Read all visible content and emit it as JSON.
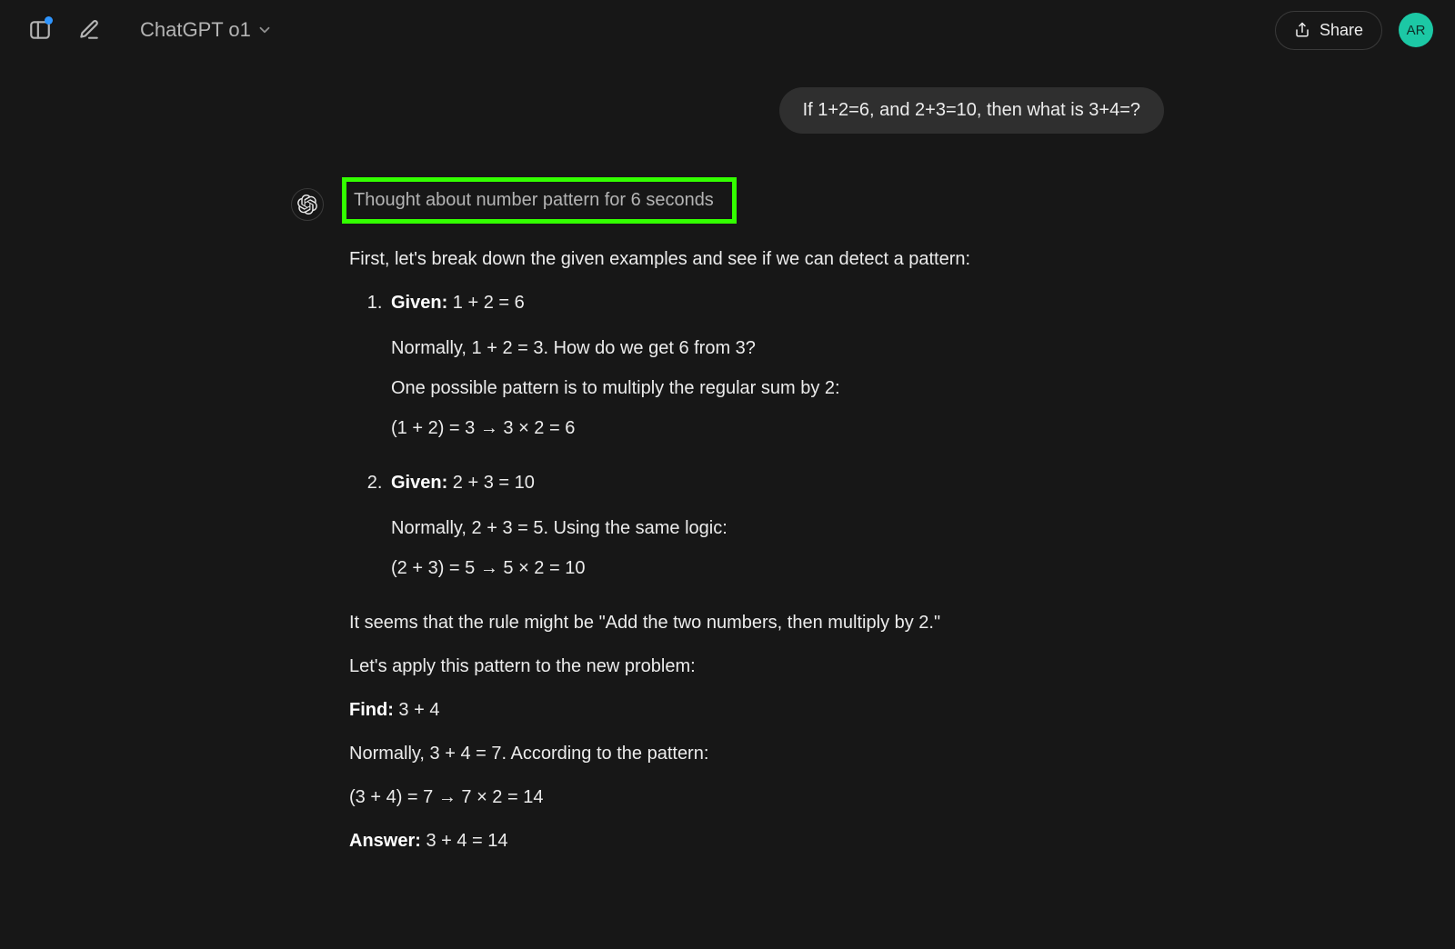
{
  "header": {
    "model_label": "ChatGPT o1",
    "share_label": "Share",
    "avatar_initials": "AR"
  },
  "conversation": {
    "user_message": "If 1+2=6, and 2+3=10, then what is 3+4=?",
    "thought_text": "Thought about number pattern for 6 seconds",
    "response": {
      "intro": "First, let's break down the given examples and see if we can detect a pattern:",
      "item1": {
        "label": "Given:",
        "eq": " 1 + 2 = 6",
        "line_a": "Normally, 1 + 2 = 3. How do we get 6 from 3?",
        "line_b": "One possible pattern is to multiply the regular sum by 2:",
        "line_c": "(1 + 2) = 3 → 3 × 2 = 6"
      },
      "item2": {
        "label": "Given:",
        "eq": " 2 + 3 = 10",
        "line_a": "Normally, 2 + 3 = 5. Using the same logic:",
        "line_b": "(2 + 3) = 5 → 5 × 2 = 10"
      },
      "rule": "It seems that the rule might be \"Add the two numbers, then multiply by 2.\"",
      "apply": "Let's apply this pattern to the new problem:",
      "find_label": "Find:",
      "find_eq": " 3 + 4",
      "normally": "Normally, 3 + 4 = 7. According to the pattern:",
      "calc": "(3 + 4) = 7 → 7 × 2 = 14",
      "answer_label": "Answer:",
      "answer_eq": " 3 + 4 = 14"
    }
  },
  "highlight_color": "#33ff00"
}
